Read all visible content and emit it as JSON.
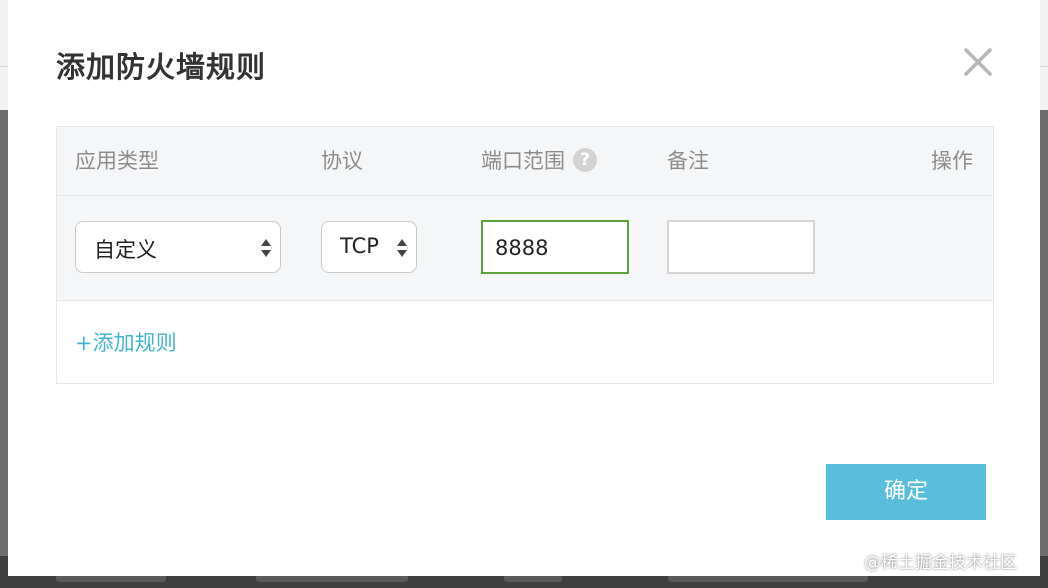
{
  "dialog": {
    "title": "添加防火墙规则",
    "close_icon": "close-icon"
  },
  "table": {
    "columns": {
      "app_type": "应用类型",
      "protocol": "协议",
      "port_range": "端口范围",
      "port_help_icon": "?",
      "note": "备注",
      "action": "操作"
    },
    "row": {
      "app_type_value": "自定义",
      "protocol_value": "TCP",
      "port_range_value": "8888",
      "note_value": ""
    },
    "add_rule_label": "+添加规则"
  },
  "footer": {
    "confirm_label": "确定"
  },
  "watermark": "@稀土掘金技术社区",
  "colors": {
    "accent": "#59bedb",
    "link": "#42b4d3",
    "active_input_border": "#5aa53a"
  }
}
